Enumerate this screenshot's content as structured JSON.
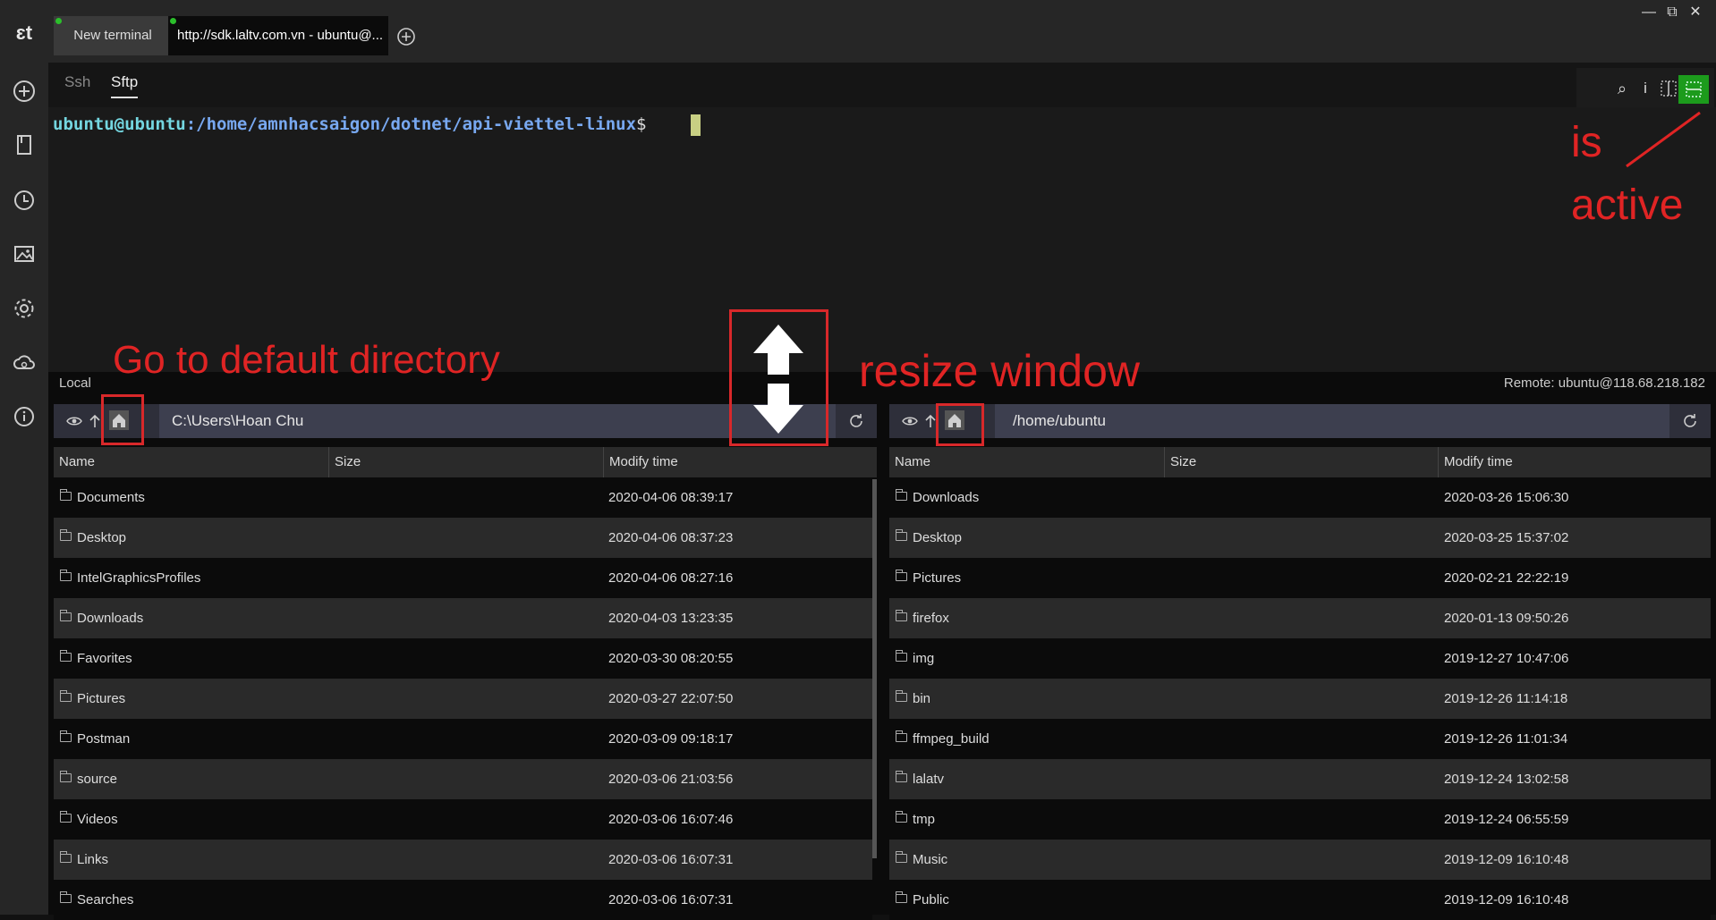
{
  "sidebar": {
    "logo": "ɛt",
    "icons": [
      "add-icon",
      "bookmark-icon",
      "history-icon",
      "image-icon",
      "settings-icon",
      "cloud-sync-icon",
      "info-icon"
    ]
  },
  "tabs": {
    "new_terminal": "New terminal",
    "remote": "http://sdk.laltv.com.vn - ubuntu@..."
  },
  "window_controls": {
    "minimize": "—",
    "maximize": "⧉",
    "close": "✕"
  },
  "subtabs": {
    "ssh": "Ssh",
    "sftp": "Sftp"
  },
  "terminal_tools": {
    "search": "⌕",
    "info": "i"
  },
  "terminal": {
    "user_host": "ubuntu@ubuntu",
    "path": ":/home/amnhacsaigon/dotnet/api-viettel-linux",
    "sign": "$"
  },
  "local": {
    "label": "Local",
    "path": "C:\\Users\\Hoan Chu",
    "columns": [
      "Name",
      "Size",
      "Modify time"
    ],
    "rows": [
      {
        "name": "Documents",
        "time": "2020-04-06 08:39:17"
      },
      {
        "name": "Desktop",
        "time": "2020-04-06 08:37:23"
      },
      {
        "name": "IntelGraphicsProfiles",
        "time": "2020-04-06 08:27:16"
      },
      {
        "name": "Downloads",
        "time": "2020-04-03 13:23:35"
      },
      {
        "name": "Favorites",
        "time": "2020-03-30 08:20:55"
      },
      {
        "name": "Pictures",
        "time": "2020-03-27 22:07:50"
      },
      {
        "name": "Postman",
        "time": "2020-03-09 09:18:17"
      },
      {
        "name": "source",
        "time": "2020-03-06 21:03:56"
      },
      {
        "name": "Videos",
        "time": "2020-03-06 16:07:46"
      },
      {
        "name": "Links",
        "time": "2020-03-06 16:07:31"
      },
      {
        "name": "Searches",
        "time": "2020-03-06 16:07:31"
      }
    ]
  },
  "remote": {
    "label": "Remote: ubuntu@118.68.218.182",
    "path": "/home/ubuntu",
    "columns": [
      "Name",
      "Size",
      "Modify time"
    ],
    "rows": [
      {
        "name": "Downloads",
        "time": "2020-03-26 15:06:30"
      },
      {
        "name": "Desktop",
        "time": "2020-03-25 15:37:02"
      },
      {
        "name": "Pictures",
        "time": "2020-02-21 22:22:19"
      },
      {
        "name": "firefox",
        "time": "2020-01-13 09:50:26"
      },
      {
        "name": "img",
        "time": "2019-12-27 10:47:06"
      },
      {
        "name": "bin",
        "time": "2019-12-26 11:14:18"
      },
      {
        "name": "ffmpeg_build",
        "time": "2019-12-26 11:01:34"
      },
      {
        "name": "lalatv",
        "time": "2019-12-24 13:02:58"
      },
      {
        "name": "tmp",
        "time": "2019-12-24 06:55:59"
      },
      {
        "name": "Music",
        "time": "2019-12-09 16:10:48"
      },
      {
        "name": "Public",
        "time": "2019-12-09 16:10:48"
      }
    ]
  },
  "annotations": {
    "home": "Go to default directory",
    "resize": "resize window",
    "is": "is",
    "active": "active"
  },
  "colors": {
    "annotation": "#e02424",
    "active_tool": "#1c9b1c",
    "prompt_user": "#74d6e0",
    "prompt_path": "#78a8f0"
  }
}
